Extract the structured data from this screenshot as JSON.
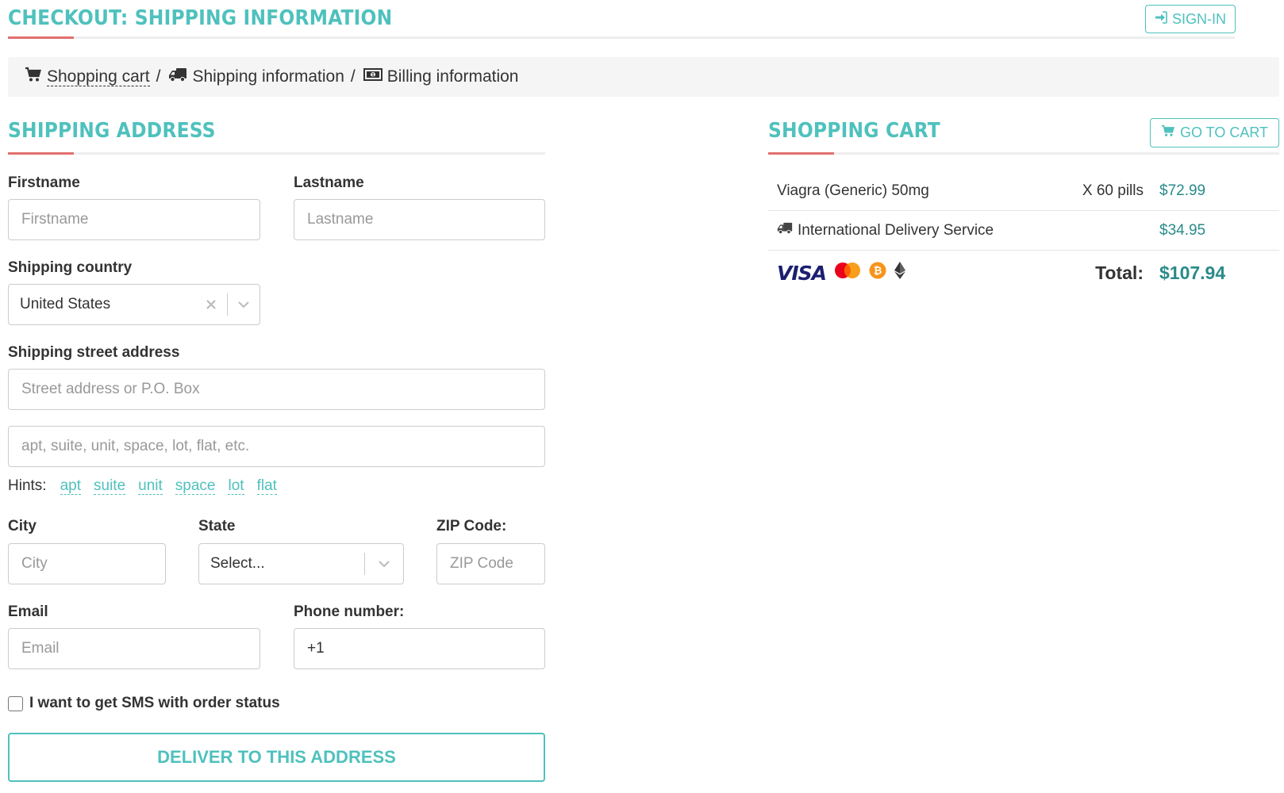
{
  "header": {
    "title": "CHECKOUT: SHIPPING INFORMATION",
    "signin_label": "SIGN-IN"
  },
  "breadcrumb": [
    {
      "label": "Shopping cart",
      "icon": "cart-icon",
      "link": true
    },
    {
      "label": "Shipping information",
      "icon": "truck-icon",
      "link": false
    },
    {
      "label": "Billing information",
      "icon": "money-icon",
      "link": false
    }
  ],
  "breadcrumb_separator": "/",
  "shipping": {
    "heading": "SHIPPING ADDRESS",
    "firstname_label": "Firstname",
    "firstname_placeholder": "Firstname",
    "lastname_label": "Lastname",
    "lastname_placeholder": "Lastname",
    "country_label": "Shipping country",
    "country_value": "United States",
    "street_label": "Shipping street address",
    "street_placeholder": "Street address or P.O. Box",
    "street2_placeholder": "apt, suite, unit, space, lot, flat, etc.",
    "hints_label": "Hints:",
    "hints": [
      "apt",
      "suite",
      "unit",
      "space",
      "lot",
      "flat"
    ],
    "city_label": "City",
    "city_placeholder": "City",
    "state_label": "State",
    "state_value": "Select...",
    "zip_label": "ZIP Code:",
    "zip_placeholder": "ZIP Code",
    "email_label": "Email",
    "email_placeholder": "Email",
    "phone_label": "Phone number:",
    "phone_value": "+1",
    "sms_label": "I want to get SMS with order status",
    "submit_label": "DELIVER TO THIS ADDRESS"
  },
  "cart": {
    "heading": "SHOPPING CART",
    "go_to_cart_label": "GO TO CART",
    "items": [
      {
        "name": "Viagra (Generic) 50mg",
        "qty": "X 60 pills",
        "price": "$72.99"
      },
      {
        "name": "International Delivery Service",
        "qty": "",
        "price": "$34.95",
        "icon": "truck-icon"
      }
    ],
    "total_label": "Total:",
    "total_value": "$107.94",
    "payment_icons": [
      "visa-logo",
      "mastercard-logo",
      "bitcoin-logo",
      "ethereum-logo"
    ],
    "visa_text": "VISA"
  },
  "colors": {
    "accent": "#4fc1bd",
    "price": "#2a8a8a",
    "heading_underline": "#e36f6f",
    "breadcrumb_bg": "#f5f5f5"
  }
}
